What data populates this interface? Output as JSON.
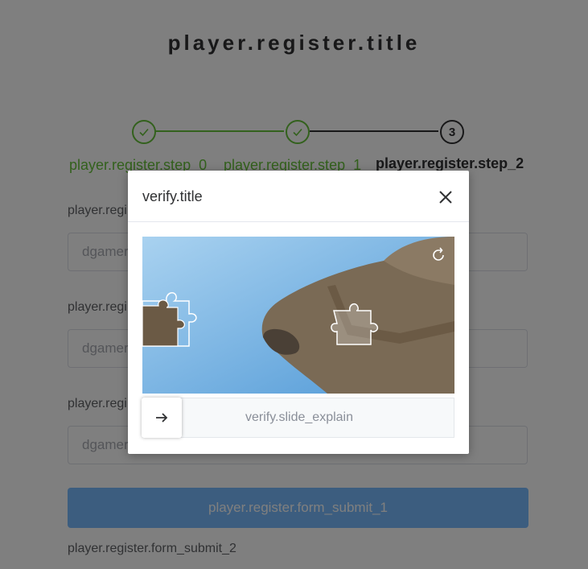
{
  "page": {
    "title": "player.register.title"
  },
  "steps": [
    {
      "label": "player.register.step_0",
      "status": "done"
    },
    {
      "label": "player.register.step_1",
      "status": "done"
    },
    {
      "label": "player.register.step_2",
      "status": "active",
      "number": "3"
    }
  ],
  "form": {
    "fields": [
      {
        "label": "player.regi",
        "value": "dgamer"
      },
      {
        "label": "player.regi",
        "value": "dgamer"
      },
      {
        "label": "player.regi",
        "value": "dgamer"
      }
    ],
    "submit_1": "player.register.form_submit_1",
    "submit_2": "player.register.form_submit_2"
  },
  "dialog": {
    "title": "verify.title",
    "slide_explain": "verify.slide_explain"
  },
  "icons": {
    "close": "close-icon",
    "refresh": "refresh-icon",
    "arrow": "arrow-right-icon",
    "check": "check-icon"
  },
  "colors": {
    "success": "#67c23a",
    "primary_light": "#79bbff",
    "text": "#303133"
  }
}
